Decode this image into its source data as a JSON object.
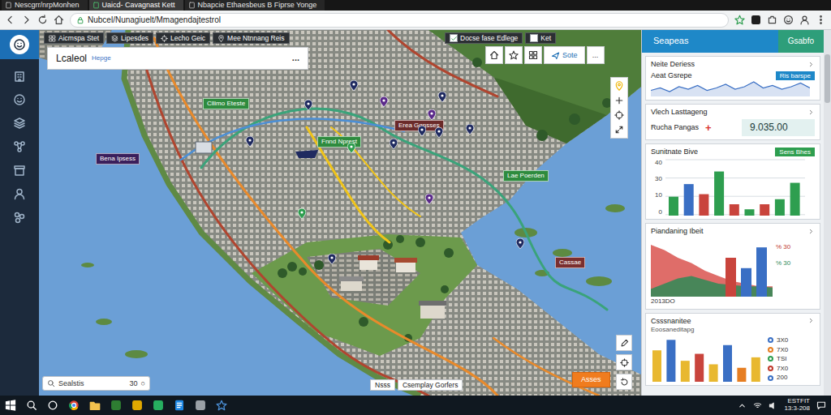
{
  "browser": {
    "tabs": [
      {
        "label": "Nescgrr/nrpMonhen",
        "selected": false
      },
      {
        "label": "Uaicd- Cavagnast Kett",
        "selected": true
      },
      {
        "label": "Nbapcie Ethaesbeus B Fiprse Yonge",
        "selected": false
      }
    ],
    "url": "Nubcel/Nunagiuelt/Mmagendajtestrol"
  },
  "map": {
    "layers": [
      {
        "label": "Aicmspa Stet"
      },
      {
        "label": "Lipesdes"
      },
      {
        "label": "Lecho Geic"
      },
      {
        "label": "Mee Ntnnang Reis"
      }
    ],
    "actions": [
      {
        "label": "Docse fase Edlege",
        "checked": true
      },
      {
        "label": "Ket",
        "checked": false
      }
    ],
    "panel": {
      "title": "Lcaleol",
      "subtitle": "Hepge",
      "menu": "..."
    },
    "tools": {
      "label": "Sote",
      "more": "..."
    },
    "labels": [
      {
        "text": "Bena Ipsess",
        "color": "#3a1f5c"
      },
      {
        "text": "Cllimo Eteste",
        "color": "#2e8b3e"
      },
      {
        "text": "Fnnd Nprest",
        "color": "#2e8b3e"
      },
      {
        "text": "Erea Ggnsses",
        "color": "#6b2a2a"
      },
      {
        "text": "Lae Poerden",
        "color": "#2e8b3e"
      },
      {
        "text": "Cassae",
        "color": "#7a2f2f"
      }
    ],
    "pins": [
      {
        "color": "#1f2a60"
      },
      {
        "color": "#1f2a60"
      },
      {
        "color": "#5b2a8a"
      },
      {
        "color": "#1f2a60"
      },
      {
        "color": "#5b2a8a"
      },
      {
        "color": "#1f2a60"
      },
      {
        "color": "#2e9e4f"
      },
      {
        "color": "#1f2a60"
      },
      {
        "color": "#1f2a60"
      },
      {
        "color": "#1f2a60"
      },
      {
        "color": "#2e9e4f"
      },
      {
        "color": "#5b2a8a"
      },
      {
        "color": "#1f2a60"
      },
      {
        "color": "#1f2a60"
      },
      {
        "color": "#1f2a60"
      }
    ],
    "search": {
      "value": "Sealstis",
      "count": "30",
      "clear": "○"
    },
    "buttons": [
      {
        "label": "Nsss"
      },
      {
        "label": "Csemplay Gorfers"
      }
    ],
    "primary": {
      "label": "Asses"
    }
  },
  "panel": {
    "tabs": [
      {
        "label": "Seapeas",
        "selected": true
      },
      {
        "label": "Gsabfo",
        "selected": false
      }
    ],
    "overview": {
      "title": "Neite Deriess",
      "row": "Aeat Gsrepe",
      "badge": "Ris barspe",
      "spark": {
        "values": [
          5,
          7,
          4,
          8,
          6,
          9,
          5,
          7,
          10,
          6,
          8,
          12,
          7,
          9,
          6,
          8,
          11,
          7
        ],
        "color": "#3a6fc4"
      }
    },
    "metric": {
      "title": "Vlech Lasttageng",
      "label": "Rucha Pangas",
      "sign": "+",
      "value": "9.035.00"
    },
    "bars": {
      "title": "Sunitnate Bive",
      "badge": "Sens Bhes",
      "ticks": [
        "0",
        "10",
        "30",
        "40"
      ],
      "bars": [
        {
          "value": 15,
          "color": "#2e9e4f"
        },
        {
          "value": 25,
          "color": "#3a6fc4"
        },
        {
          "value": 17,
          "color": "#c9443c"
        },
        {
          "value": 35,
          "color": "#2e9e4f"
        },
        {
          "value": 9,
          "color": "#c9443c"
        },
        {
          "value": 5,
          "color": "#2e9e4f"
        },
        {
          "value": 9,
          "color": "#c9443c"
        },
        {
          "value": 13,
          "color": "#2e9e4f"
        },
        {
          "value": 26,
          "color": "#2e9e4f"
        }
      ]
    },
    "trend": {
      "title": "Piandaning Ibeit",
      "labels": [
        {
          "text": "% 30",
          "color": "#c0392b"
        },
        {
          "text": "% 30",
          "color": "#2e8b57"
        }
      ],
      "axis": "2013DO",
      "series": [
        {
          "values": [
            40,
            36,
            30,
            26,
            20,
            16,
            12,
            10,
            8,
            8
          ],
          "color": "#d9534f"
        },
        {
          "values": [
            6,
            10,
            14,
            16,
            13,
            10,
            9,
            8,
            8,
            7
          ],
          "color": "#2e8b57"
        }
      ],
      "bars": [
        {
          "value": 30,
          "color": "#c9443c"
        },
        {
          "value": 22,
          "color": "#3a6fc4"
        },
        {
          "value": 38,
          "color": "#3a6fc4"
        }
      ]
    },
    "breakdown": {
      "title": "Csssnanitee",
      "subtitle": "Eoosaneditapg",
      "bars": [
        {
          "value": 18,
          "color": "#e8b830"
        },
        {
          "value": 24,
          "color": "#3a6fc4"
        },
        {
          "value": 12,
          "color": "#e8b830"
        },
        {
          "value": 16,
          "color": "#c9443c"
        },
        {
          "value": 10,
          "color": "#e8b830"
        },
        {
          "value": 21,
          "color": "#3a6fc4"
        },
        {
          "value": 8,
          "color": "#e67e22"
        },
        {
          "value": 14,
          "color": "#e8b830"
        }
      ],
      "legend": [
        {
          "text": "3X0",
          "color": "#3a6fc4"
        },
        {
          "text": "7X0",
          "color": "#e67e22"
        },
        {
          "text": "TSI",
          "color": "#2e9e4f"
        },
        {
          "text": "7X0",
          "color": "#c0392b"
        },
        {
          "text": "200",
          "color": "#3a6fc4"
        }
      ]
    }
  },
  "taskbar": {
    "clock": [
      "ESTFIT",
      "13:3-208"
    ]
  }
}
